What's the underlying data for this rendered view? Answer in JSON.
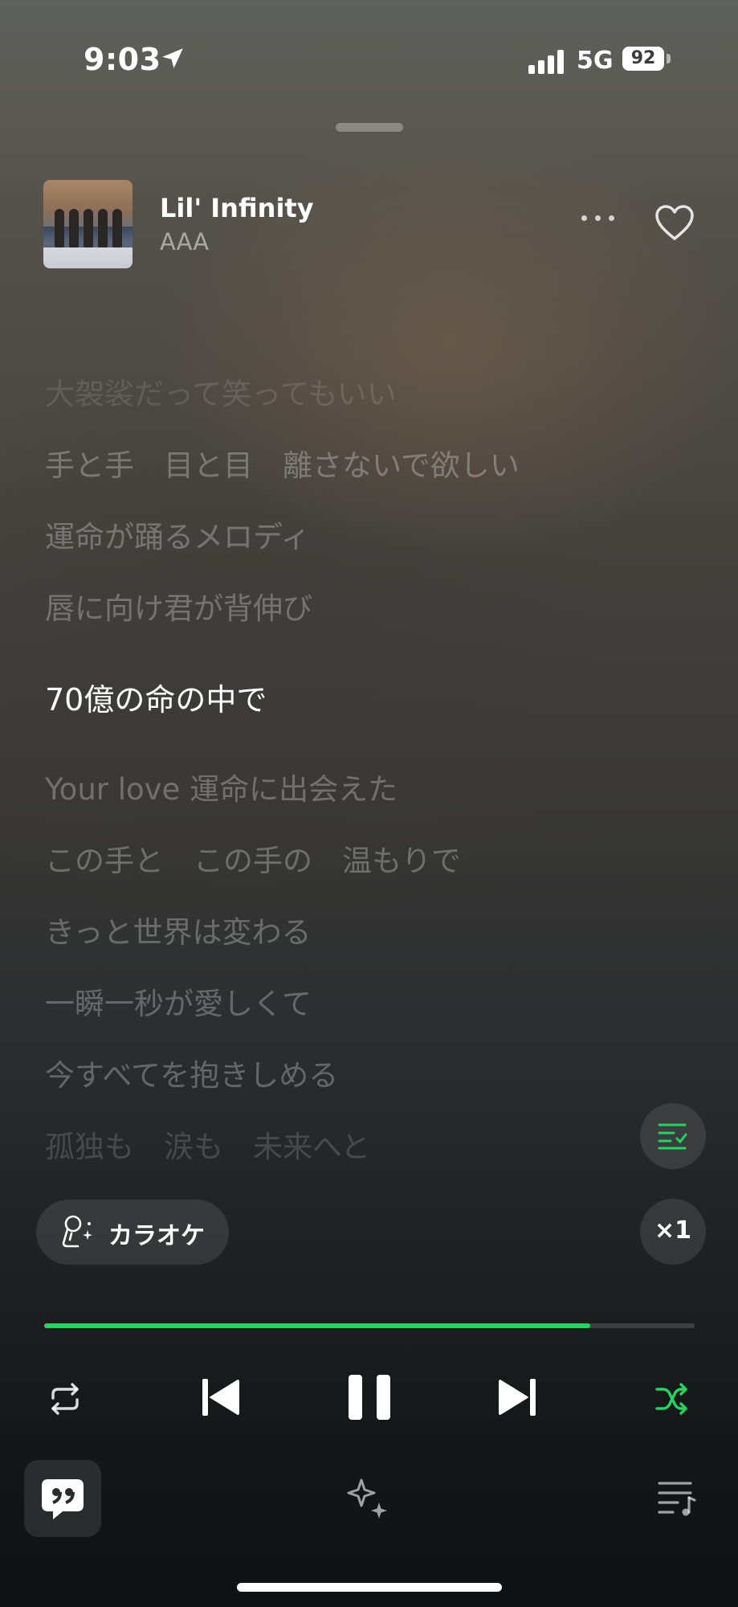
{
  "status_bar": {
    "time": "9:03",
    "network": "5G",
    "battery": "92"
  },
  "track": {
    "title": "Lil' Infinity",
    "artist": "AAA",
    "artwork_text": "AAA"
  },
  "lyrics": {
    "lines": [
      "大袈裟だって笑ってもいい",
      "手と手　目と目　離さないで欲しい",
      "運命が踊るメロディ",
      "唇に向け君が背伸び",
      "70億の命の中で",
      "Your love 運命に出会えた",
      "この手と　この手の　温もりで",
      "きっと世界は変わる",
      "一瞬一秒が愛しくて",
      "今すべてを抱きしめる",
      "孤独も　涙も　未来へと"
    ],
    "current_index": 4
  },
  "karaoke": {
    "label": "カラオケ"
  },
  "speed": {
    "label": "×1"
  },
  "playback": {
    "progress": 0.84,
    "state": "playing",
    "shuffle": true
  },
  "colors": {
    "accent": "#1ed760",
    "background_top": "#5f615c",
    "background_bottom": "#0f1113"
  },
  "icons": [
    "location-arrow-icon",
    "signal-icon",
    "more-icon",
    "heart-icon",
    "lyrics-sync-icon",
    "karaoke-mic-icon",
    "repeat-icon",
    "previous-icon",
    "pause-icon",
    "next-icon",
    "shuffle-icon",
    "quote-icon",
    "sparkle-icon",
    "queue-icon"
  ]
}
